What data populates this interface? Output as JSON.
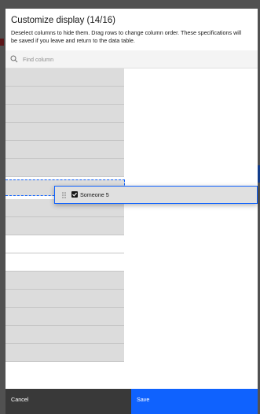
{
  "modal": {
    "title": "Customize display (14/16)",
    "description": "Deselect columns to hide them. Drag rows to change column order. These specifications will be saved if you leave and return to the data table."
  },
  "search": {
    "placeholder": "Find column",
    "icon": "search-icon"
  },
  "dragged_row": {
    "label": "Someone 5",
    "checked": true,
    "icon": "drag-handle-icon"
  },
  "footer": {
    "cancel_label": "Cancel",
    "save_label": "Save"
  },
  "colors": {
    "primary": "#0f62fe",
    "secondary_button": "#393939",
    "row_background": "#dcdcdc"
  }
}
